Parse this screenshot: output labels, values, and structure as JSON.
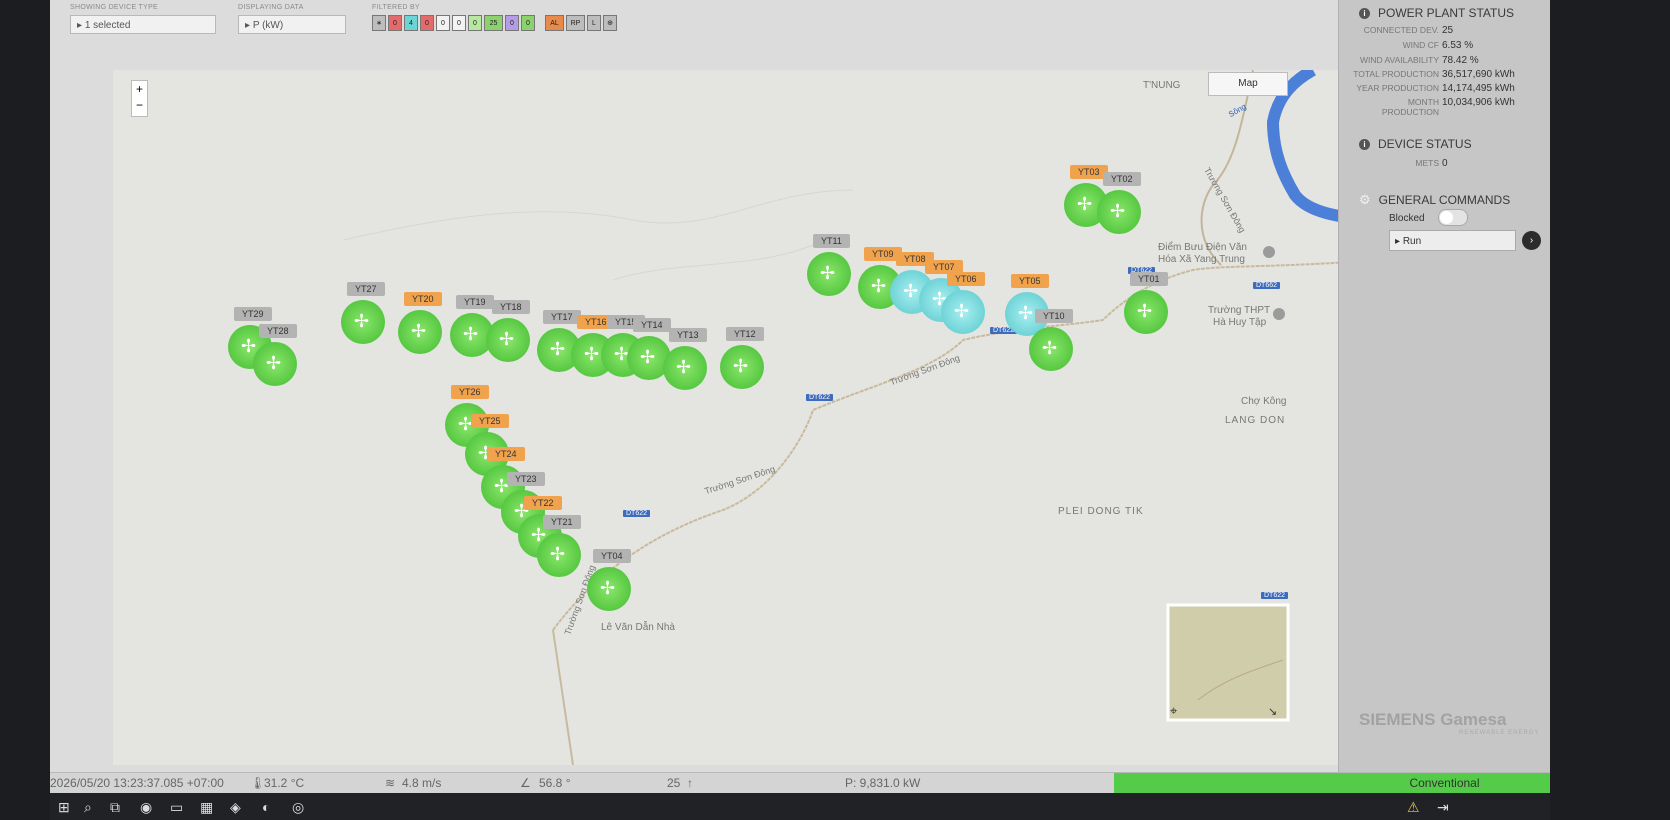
{
  "filters": {
    "device_type_label": "SHOWING DEVICE TYPE",
    "device_type_value": "1 selected",
    "data_label": "DISPLAYING DATA",
    "data_value": "P (kW)",
    "filtered_label": "FILTERED BY",
    "chips": [
      {
        "text": "∗",
        "color": "#bdbdbd"
      },
      {
        "text": "0",
        "color": "#e56b6b"
      },
      {
        "text": "4",
        "color": "#6bd4d4"
      },
      {
        "text": "0",
        "color": "#e56b6b"
      },
      {
        "text": "0",
        "color": "#f2f2f2"
      },
      {
        "text": "0",
        "color": "#f2f2f2"
      },
      {
        "text": "0",
        "color": "#b8e8a0"
      },
      {
        "text": "25",
        "color": "#8bd26d"
      },
      {
        "text": "0",
        "color": "#b49de5"
      },
      {
        "text": "0",
        "color": "#8bd26d"
      }
    ],
    "chips2": [
      {
        "text": "AL",
        "color": "#e98a4a"
      },
      {
        "text": "RP",
        "color": "#bdbdbd"
      },
      {
        "text": "L",
        "color": "#bdbdbd"
      },
      {
        "text": "⊕",
        "color": "#bdbdbd"
      }
    ]
  },
  "map": {
    "type_button": "Map",
    "zoom_in": "+",
    "zoom_out": "−",
    "places": {
      "tnung": "T'NUNG",
      "post_office_1": "Điểm Bưu Điện Văn",
      "post_office_2": "Hóa Xã Yang Trung",
      "school_1": "Trường THPT",
      "school_2": "Hà Huy Tập",
      "cho_kong": "Chợ Kông",
      "lang_don": "LANG DON",
      "plei": "PLEI DONG TIK",
      "road1": "Trường Sơn Đông",
      "road2": "Trường Sơn Đông",
      "road3": "Trường Sơn Đông",
      "road4": "Trường Sơn Đông",
      "river": "Sông",
      "bottom_place": "Lê Văn Dẫn Nhà",
      "dt1": "DT622",
      "dt2": "DT622",
      "dt3": "DT622",
      "dt4": "DT622",
      "dt5": "DT662",
      "dt6": "DT622"
    },
    "turbines": [
      {
        "id": "YT29",
        "status": "ok"
      },
      {
        "id": "YT28",
        "status": "ok"
      },
      {
        "id": "YT27",
        "status": "ok"
      },
      {
        "id": "YT20",
        "status": "alarm"
      },
      {
        "id": "YT19",
        "status": "ok"
      },
      {
        "id": "YT18",
        "status": "ok"
      },
      {
        "id": "YT17",
        "status": "ok"
      },
      {
        "id": "YT16",
        "status": "alarm"
      },
      {
        "id": "YT15",
        "status": "ok"
      },
      {
        "id": "YT14",
        "status": "ok"
      },
      {
        "id": "YT13",
        "status": "ok"
      },
      {
        "id": "YT12",
        "status": "ok"
      },
      {
        "id": "YT11",
        "status": "ok"
      },
      {
        "id": "YT09",
        "status": "alarm"
      },
      {
        "id": "YT08",
        "status": "alarm"
      },
      {
        "id": "YT07",
        "status": "alarm"
      },
      {
        "id": "YT06",
        "status": "alarm"
      },
      {
        "id": "YT05",
        "status": "alarm"
      },
      {
        "id": "YT10",
        "status": "ok"
      },
      {
        "id": "YT03",
        "status": "alarm"
      },
      {
        "id": "YT02",
        "status": "ok"
      },
      {
        "id": "YT01",
        "status": "ok"
      },
      {
        "id": "YT26",
        "status": "alarm"
      },
      {
        "id": "YT25",
        "status": "alarm"
      },
      {
        "id": "YT24",
        "status": "alarm"
      },
      {
        "id": "YT23",
        "status": "ok"
      },
      {
        "id": "YT22",
        "status": "alarm"
      },
      {
        "id": "YT21",
        "status": "ok"
      },
      {
        "id": "YT04",
        "status": "ok"
      }
    ],
    "colors": {
      "running": "#5ccb45",
      "stopped": "#6fd3d6",
      "alarm_tag": "#f0a34c",
      "ok_tag": "#b3b3b3"
    }
  },
  "plant_status": {
    "title": "POWER PLANT STATUS",
    "rows": [
      {
        "k": "CONNECTED DEV.",
        "v": "25"
      },
      {
        "k": "WIND CF",
        "v": "6.53 %"
      },
      {
        "k": "WIND AVAILABILITY",
        "v": "78.42 %"
      },
      {
        "k": "TOTAL PRODUCTION",
        "v": "36,517,690 kWh"
      },
      {
        "k": "YEAR PRODUCTION",
        "v": "14,174,495 kWh"
      },
      {
        "k": "MONTH PRODUCTION",
        "v": "10,034,906 kWh"
      }
    ]
  },
  "device_status": {
    "title": "DEVICE STATUS",
    "k": "METS",
    "v": "0"
  },
  "commands": {
    "title": "GENERAL COMMANDS",
    "blocked_label": "Blocked",
    "run_label": "Run"
  },
  "brand": {
    "name": "SIEMENS Gamesa",
    "sub": "RENEWABLE ENERGY"
  },
  "status": {
    "datetime": "2026/05/20 13:23:37.085 +07:00",
    "temp": "31.2 °C",
    "wind_speed": "4.8 m/s",
    "wind_dir": "56.8 °",
    "count": "25",
    "power": "P: 9,831.0 kW",
    "mode": "Conventional"
  }
}
